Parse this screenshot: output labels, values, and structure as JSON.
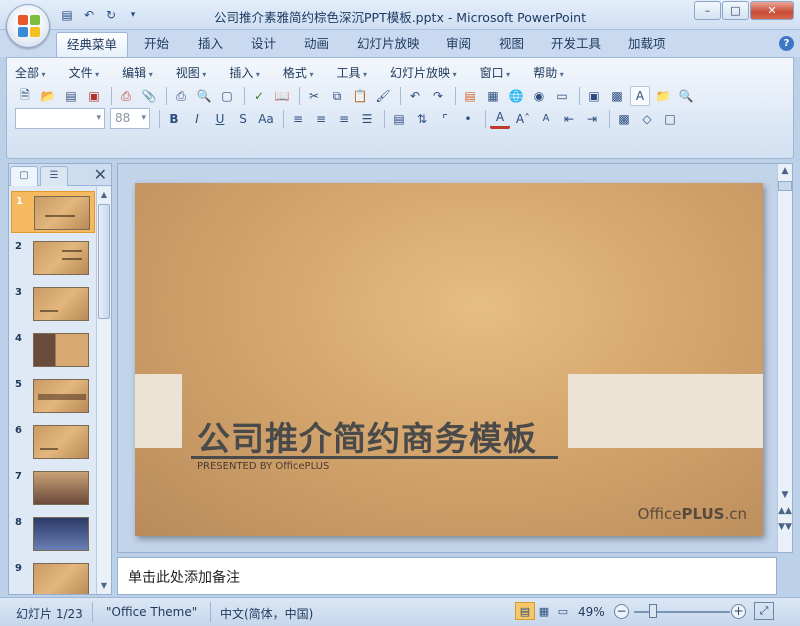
{
  "window": {
    "title": "公司推介素雅简约棕色深沉PPT模板.pptx - Microsoft PowerPoint",
    "controls": {
      "minimize": "–",
      "maximize": "□",
      "close": "✕"
    }
  },
  "quick_access": [
    "save-icon",
    "undo-icon",
    "redo-icon",
    "customize-icon"
  ],
  "ribbon_tabs": [
    {
      "label": "经典菜单",
      "active": true
    },
    {
      "label": "开始"
    },
    {
      "label": "插入"
    },
    {
      "label": "设计"
    },
    {
      "label": "动画"
    },
    {
      "label": "幻灯片放映"
    },
    {
      "label": "审阅"
    },
    {
      "label": "视图"
    },
    {
      "label": "开发工具"
    },
    {
      "label": "加载项"
    }
  ],
  "classic_menu": [
    "全部",
    "文件",
    "编辑",
    "视图",
    "插入",
    "格式",
    "工具",
    "幻灯片放映",
    "窗口",
    "帮助"
  ],
  "format_bar": {
    "font_name": "",
    "font_size": "88"
  },
  "slides_panel": {
    "slide_numbers": [
      "1",
      "2",
      "3",
      "4",
      "5",
      "6",
      "7",
      "8",
      "9"
    ],
    "selected": "1"
  },
  "slide": {
    "title": "公司推介简约商务模板",
    "subtitle": "PRESENTED BY OfficePLUS",
    "brand_regular": "Office",
    "brand_bold": "PLUS",
    "brand_suffix": ".cn"
  },
  "notes": {
    "placeholder": "单击此处添加备注"
  },
  "status": {
    "slide_position": "幻灯片 1/23",
    "theme": "\"Office Theme\"",
    "language": "中文(简体，中国)",
    "zoom": "49%"
  },
  "colors": {
    "slide_bg": "#d4a56c",
    "accent_band": "#ece3d5",
    "title_text": "#4a4a4a",
    "selected_thumb": "#f7b95f"
  }
}
